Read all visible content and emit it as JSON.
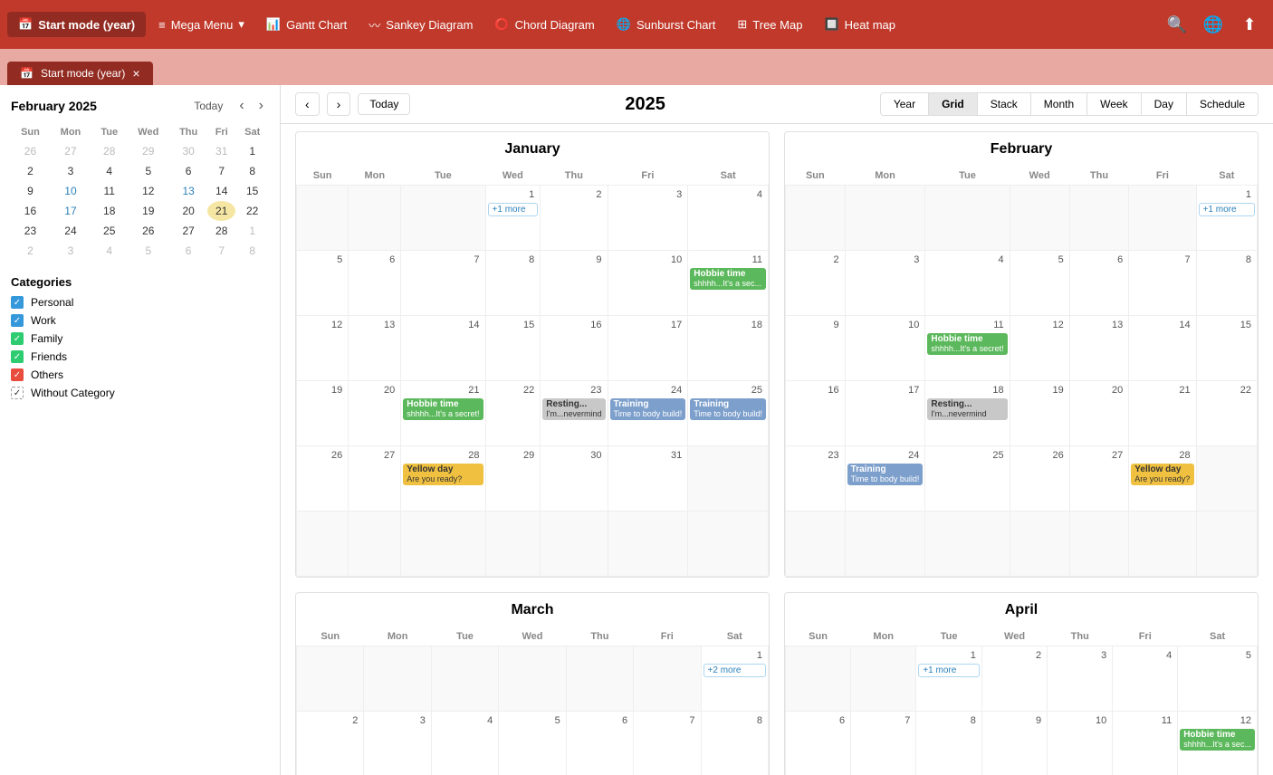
{
  "nav": {
    "brand_label": "Start mode (year)",
    "items": [
      {
        "label": "Mega Menu",
        "icon": "menu-icon",
        "has_arrow": true
      },
      {
        "label": "Gantt Chart",
        "icon": "gantt-icon"
      },
      {
        "label": "Sankey Diagram",
        "icon": "sankey-icon"
      },
      {
        "label": "Chord Diagram",
        "icon": "chord-icon"
      },
      {
        "label": "Sunburst Chart",
        "icon": "sunburst-icon"
      },
      {
        "label": "Tree Map",
        "icon": "tree-icon"
      },
      {
        "label": "Heat map",
        "icon": "heat-icon"
      }
    ],
    "search_icon": "🔍",
    "globe_icon": "🌐",
    "export_icon": "⬆"
  },
  "tab": {
    "label": "Start mode (year)",
    "close": "×"
  },
  "sidebar": {
    "mini_cal_title": "February 2025",
    "today_label": "Today",
    "days_header": [
      "Sun",
      "Mon",
      "Tue",
      "Wed",
      "Thu",
      "Fri",
      "Sat"
    ],
    "weeks": [
      [
        {
          "d": "26",
          "other": true
        },
        {
          "d": "27",
          "other": true
        },
        {
          "d": "28",
          "other": true
        },
        {
          "d": "29",
          "other": true
        },
        {
          "d": "30",
          "other": true
        },
        {
          "d": "31",
          "other": true
        },
        {
          "d": "1"
        }
      ],
      [
        {
          "d": "2"
        },
        {
          "d": "3"
        },
        {
          "d": "4"
        },
        {
          "d": "5"
        },
        {
          "d": "6"
        },
        {
          "d": "7"
        },
        {
          "d": "8"
        }
      ],
      [
        {
          "d": "9"
        },
        {
          "d": "10",
          "blue": true
        },
        {
          "d": "11"
        },
        {
          "d": "12"
        },
        {
          "d": "13",
          "blue": true
        },
        {
          "d": "14"
        },
        {
          "d": "15"
        }
      ],
      [
        {
          "d": "16"
        },
        {
          "d": "17",
          "blue": true
        },
        {
          "d": "18"
        },
        {
          "d": "19"
        },
        {
          "d": "20"
        },
        {
          "d": "21",
          "selected": true
        },
        {
          "d": "22"
        }
      ],
      [
        {
          "d": "23"
        },
        {
          "d": "24"
        },
        {
          "d": "25"
        },
        {
          "d": "26"
        },
        {
          "d": "27"
        },
        {
          "d": "28"
        },
        {
          "d": "1",
          "other": true
        }
      ],
      [
        {
          "d": "2",
          "other": true
        },
        {
          "d": "3",
          "other": true
        },
        {
          "d": "4",
          "other": true
        },
        {
          "d": "5",
          "other": true
        },
        {
          "d": "6",
          "other": true
        },
        {
          "d": "7",
          "other": true
        },
        {
          "d": "8",
          "other": true
        }
      ]
    ],
    "categories_title": "Categories",
    "categories": [
      {
        "label": "Personal",
        "color": "#3498db",
        "checked": true
      },
      {
        "label": "Work",
        "color": "#3498db",
        "checked": true
      },
      {
        "label": "Family",
        "color": "#2ecc71",
        "checked": true
      },
      {
        "label": "Friends",
        "color": "#2ecc71",
        "checked": true
      },
      {
        "label": "Others",
        "color": "#e74c3c",
        "checked": true
      },
      {
        "label": "Without Category",
        "color": "#fff",
        "checked": true,
        "border": true
      }
    ]
  },
  "calendar": {
    "today_label": "Today",
    "year": "2025",
    "views": [
      "Year",
      "Grid",
      "Stack",
      "Month",
      "Week",
      "Day",
      "Schedule"
    ],
    "active_view": "Grid",
    "months": [
      {
        "name": "January",
        "days_header": [
          "Sun",
          "Mon",
          "Tue",
          "Wed",
          "Thu",
          "Fri",
          "Sat"
        ],
        "weeks": [
          [
            {
              "d": "",
              "other": true
            },
            {
              "d": "",
              "other": true
            },
            {
              "d": "",
              "other": true
            },
            {
              "d": "1",
              "events": [
                {
                  "type": "more",
                  "label": "+1 more"
                }
              ]
            },
            {
              "d": "2"
            },
            {
              "d": "3"
            },
            {
              "d": "4"
            }
          ],
          [
            {
              "d": "5"
            },
            {
              "d": "6"
            },
            {
              "d": "7"
            },
            {
              "d": "8"
            },
            {
              "d": "9"
            },
            {
              "d": "10"
            },
            {
              "d": "11",
              "events": [
                {
                  "type": "green",
                  "label": "Hobbie time",
                  "sub": "shhhh...It's a sec..."
                }
              ]
            }
          ],
          [
            {
              "d": "12"
            },
            {
              "d": "13"
            },
            {
              "d": "14"
            },
            {
              "d": "15"
            },
            {
              "d": "16"
            },
            {
              "d": "17"
            },
            {
              "d": "18"
            }
          ],
          [
            {
              "d": "19"
            },
            {
              "d": "20"
            },
            {
              "d": "21",
              "events": [
                {
                  "type": "green",
                  "label": "Hobbie time",
                  "sub": "shhhh...It's a secret!"
                }
              ]
            },
            {
              "d": "22"
            },
            {
              "d": "23",
              "events": [
                {
                  "type": "gray",
                  "label": "Resting...",
                  "sub": "I'm...nevermind"
                }
              ]
            },
            {
              "d": "24",
              "events": [
                {
                  "type": "blue",
                  "label": "Training",
                  "sub": "Time to body build!"
                }
              ]
            },
            {
              "d": "25",
              "events": [
                {
                  "type": "blue",
                  "label": "Training",
                  "sub": "Time to body build!"
                }
              ]
            }
          ],
          [
            {
              "d": "26"
            },
            {
              "d": "27"
            },
            {
              "d": "28",
              "events": [
                {
                  "type": "yellow",
                  "label": "Yellow day",
                  "sub": "Are you ready?"
                }
              ]
            },
            {
              "d": "29"
            },
            {
              "d": "30"
            },
            {
              "d": "31"
            },
            {
              "d": "",
              "other": true
            }
          ],
          [
            {
              "d": "",
              "other": true
            },
            {
              "d": "",
              "other": true
            },
            {
              "d": "",
              "other": true
            },
            {
              "d": "",
              "other": true
            },
            {
              "d": "",
              "other": true
            },
            {
              "d": "",
              "other": true
            },
            {
              "d": "",
              "other": true
            }
          ]
        ]
      },
      {
        "name": "February",
        "days_header": [
          "Sun",
          "Mon",
          "Tue",
          "Wed",
          "Thu",
          "Fri",
          "Sat"
        ],
        "weeks": [
          [
            {
              "d": "",
              "other": true
            },
            {
              "d": "",
              "other": true
            },
            {
              "d": "",
              "other": true
            },
            {
              "d": "",
              "other": true
            },
            {
              "d": "",
              "other": true
            },
            {
              "d": "",
              "other": true
            },
            {
              "d": "1",
              "events": [
                {
                  "type": "more",
                  "label": "+1 more"
                }
              ]
            }
          ],
          [
            {
              "d": "2"
            },
            {
              "d": "3"
            },
            {
              "d": "4"
            },
            {
              "d": "5"
            },
            {
              "d": "6"
            },
            {
              "d": "7"
            },
            {
              "d": "8"
            }
          ],
          [
            {
              "d": "9"
            },
            {
              "d": "10"
            },
            {
              "d": "11",
              "events": [
                {
                  "type": "green",
                  "label": "Hobbie time",
                  "sub": "shhhh...It's a secret!"
                }
              ]
            },
            {
              "d": "12"
            },
            {
              "d": "13"
            },
            {
              "d": "14"
            },
            {
              "d": "15"
            }
          ],
          [
            {
              "d": "16"
            },
            {
              "d": "17"
            },
            {
              "d": "18",
              "events": [
                {
                  "type": "gray",
                  "label": "Resting...",
                  "sub": "I'm...nevermind"
                }
              ]
            },
            {
              "d": "19"
            },
            {
              "d": "20"
            },
            {
              "d": "21"
            },
            {
              "d": "22"
            }
          ],
          [
            {
              "d": "23"
            },
            {
              "d": "24",
              "events": [
                {
                  "type": "blue",
                  "label": "Training",
                  "sub": "Time to body build!"
                }
              ]
            },
            {
              "d": "25"
            },
            {
              "d": "26"
            },
            {
              "d": "27"
            },
            {
              "d": "28",
              "events": [
                {
                  "type": "yellow",
                  "label": "Yellow day",
                  "sub": "Are you ready?"
                }
              ]
            },
            {
              "d": "",
              "other": true
            }
          ],
          [
            {
              "d": "",
              "other": true
            },
            {
              "d": "",
              "other": true
            },
            {
              "d": "",
              "other": true
            },
            {
              "d": "",
              "other": true
            },
            {
              "d": "",
              "other": true
            },
            {
              "d": "",
              "other": true
            },
            {
              "d": "",
              "other": true
            }
          ]
        ]
      },
      {
        "name": "March",
        "days_header": [
          "Sun",
          "Mon",
          "Tue",
          "Wed",
          "Thu",
          "Fri",
          "Sat"
        ],
        "weeks": [
          [
            {
              "d": "",
              "other": true
            },
            {
              "d": "",
              "other": true
            },
            {
              "d": "",
              "other": true
            },
            {
              "d": "",
              "other": true
            },
            {
              "d": "",
              "other": true
            },
            {
              "d": "",
              "other": true
            },
            {
              "d": "1",
              "events": [
                {
                  "type": "more",
                  "label": "+2 more"
                }
              ]
            }
          ],
          [
            {
              "d": "2"
            },
            {
              "d": "3"
            },
            {
              "d": "4"
            },
            {
              "d": "5"
            },
            {
              "d": "6"
            },
            {
              "d": "7"
            },
            {
              "d": "8"
            }
          ]
        ]
      },
      {
        "name": "April",
        "days_header": [
          "Sun",
          "Mon",
          "Tue",
          "Wed",
          "Thu",
          "Fri",
          "Sat"
        ],
        "weeks": [
          [
            {
              "d": "",
              "other": true
            },
            {
              "d": "",
              "other": true
            },
            {
              "d": "1",
              "events": [
                {
                  "type": "more",
                  "label": "+1 more"
                }
              ]
            },
            {
              "d": "2"
            },
            {
              "d": "3"
            },
            {
              "d": "4"
            },
            {
              "d": "5"
            }
          ],
          [
            {
              "d": "6"
            },
            {
              "d": "7"
            },
            {
              "d": "8"
            },
            {
              "d": "9"
            },
            {
              "d": "10"
            },
            {
              "d": "11"
            },
            {
              "d": "12",
              "events": [
                {
                  "type": "green",
                  "label": "Hobbie time",
                  "sub": "shhhh...It's a sec..."
                }
              ]
            }
          ]
        ]
      }
    ]
  }
}
